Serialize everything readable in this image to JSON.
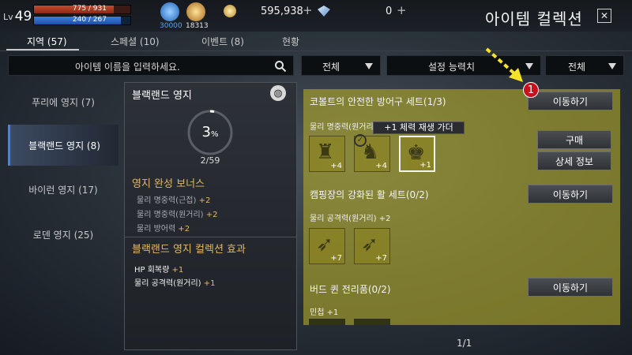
{
  "player": {
    "level_label": "Lv",
    "level": "49",
    "hp": "775 / 931",
    "hp_fraction": 0.83,
    "mp": "240 / 267",
    "mp_fraction": 0.9
  },
  "resources": [
    {
      "name": "blue-energy-icon",
      "value": "30000",
      "color": "#3a8be6"
    },
    {
      "name": "gold-emblem-icon",
      "value": "18313",
      "color": "#d8a43a"
    }
  ],
  "currencies": [
    {
      "name": "gold-coin-icon",
      "value": "595,938"
    },
    {
      "name": "diamond-icon",
      "value": "0"
    }
  ],
  "screen_title": "아이템 컬렉션",
  "tabs": [
    {
      "label": "지역 (57)"
    },
    {
      "label": "스페셜 (10)"
    },
    {
      "label": "이벤트 (8)"
    },
    {
      "label": "현황"
    }
  ],
  "search": {
    "placeholder": "아이템 이름을 입력하세요."
  },
  "filters": [
    "전체",
    "설정 능력치",
    "전체"
  ],
  "regions": [
    {
      "label": "푸리에 영지 (7)"
    },
    {
      "label": "블랙랜드 영지 (8)"
    },
    {
      "label": "바이런 영지 (17)"
    },
    {
      "label": "로덴 영지 (25)"
    }
  ],
  "territory": {
    "title": "블랙랜드 영지",
    "percent": "3",
    "percent_unit": "%",
    "progress_fraction": 0.03,
    "count": "2/59",
    "bonus_heading": "영지 완성 보너스",
    "bonuses": [
      {
        "stat": "물리 명중력(근접)",
        "value": "+2"
      },
      {
        "stat": "물리 명중력(원거리)",
        "value": "+2"
      },
      {
        "stat": "물리 방어력",
        "value": "+2"
      }
    ],
    "effect_heading": "블랙랜드 영지 컬렉션 효과",
    "effects": [
      {
        "stat": "HP 회복량",
        "value": "+1"
      },
      {
        "stat": "물리 공격력(원거리)",
        "value": "+1"
      }
    ]
  },
  "collections": [
    {
      "title": "코볼트의 안전한 방어구 세트(1/3)",
      "stat": "물리 명중력(원거리) +2",
      "move_label": "이동하기",
      "slots": [
        "+4",
        "+4",
        "+1"
      ]
    },
    {
      "title": "캠핑장의 강화된 활 세트(0/2)",
      "stat": "물리 공격력(원거리) +2",
      "move_label": "이동하기",
      "slots": [
        "+7",
        "+7"
      ]
    },
    {
      "title": "버드 퀸 전리품(0/2)",
      "stat": "민첩 +1",
      "move_label": "이동하기",
      "slots": []
    }
  ],
  "tooltip": "+1 체력 재생 가더",
  "buy_label": "구매",
  "detail_label": "상세 정보",
  "pager": "1/1",
  "callout_number": "1",
  "colors": {
    "accent_gold": "#e0b86a",
    "highlight": "#b0a828",
    "badge_red": "#c8111b"
  }
}
